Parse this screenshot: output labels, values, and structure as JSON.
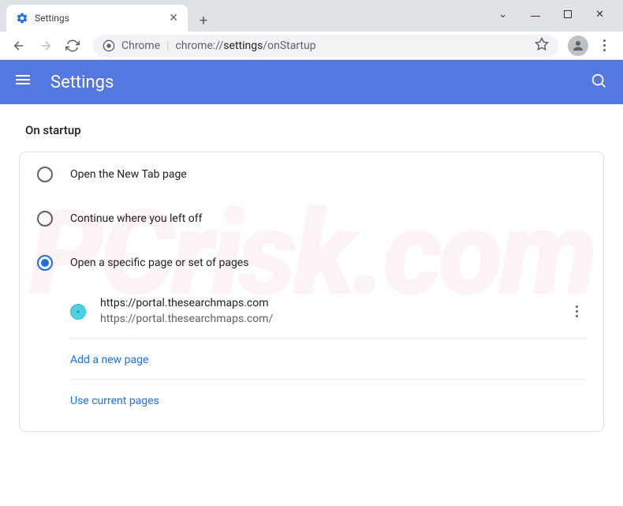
{
  "tab": {
    "title": "Settings"
  },
  "url": {
    "app": "Chrome",
    "prefix": "chrome://",
    "bold": "settings",
    "suffix": "/onStartup"
  },
  "header": {
    "title": "Settings"
  },
  "section": {
    "title": "On startup"
  },
  "options": [
    {
      "label": "Open the New Tab page",
      "selected": false
    },
    {
      "label": "Continue where you left off",
      "selected": false
    },
    {
      "label": "Open a specific page or set of pages",
      "selected": true
    }
  ],
  "pages": [
    {
      "title": "https://portal.thesearchmaps.com",
      "url": "https://portal.thesearchmaps.com/"
    }
  ],
  "links": {
    "add": "Add a new page",
    "current": "Use current pages"
  },
  "watermark": "PCrisk.com"
}
